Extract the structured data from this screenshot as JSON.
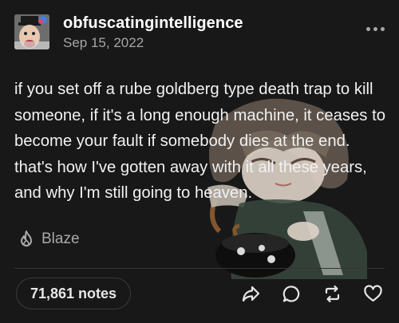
{
  "post": {
    "username": "obfuscatingintelligence",
    "date": "Sep 15, 2022",
    "body": "if you set off a rube goldberg type death trap to kill someone, if it's a long enough machine, it ceases to become your fault if somebody dies at the end. that's how I've gotten away with it all these years, and why I'm still going to heaven.",
    "tag": "Blaze",
    "notes": "71,861 notes"
  },
  "icons": {
    "menu": "more-horizontal-icon",
    "tag": "flame-icon",
    "share": "share-arrow-icon",
    "reply": "speech-bubble-icon",
    "reblog": "reblog-icon",
    "like": "heart-icon"
  },
  "colors": {
    "background": "#181818",
    "text": "#f1f1f1",
    "muted": "#a7a7a7",
    "border": "#3a3a3a"
  }
}
